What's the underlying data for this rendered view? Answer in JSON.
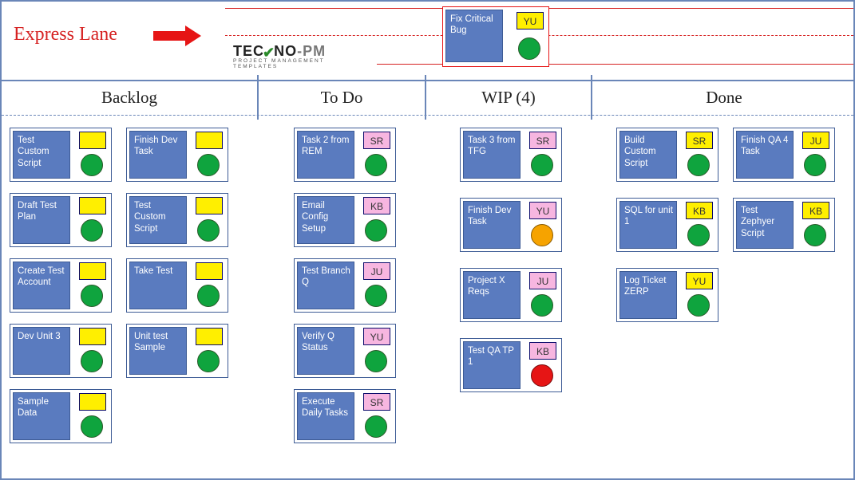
{
  "express_lane_label": "Express Lane",
  "logo": {
    "line1_a": "TEC",
    "tick": "✔",
    "line1_b": "NO",
    "gray": "-PM",
    "line2": "PROJECT MANAGEMENT TEMPLATES"
  },
  "express_card": {
    "title": "Fix\nCritical\nBug",
    "badge": "YU",
    "badge_color": "yellow",
    "status": "green"
  },
  "columns": [
    {
      "label": "Backlog"
    },
    {
      "label": "To Do"
    },
    {
      "label": "WIP (4)"
    },
    {
      "label": "Done"
    }
  ],
  "backlog_left": [
    {
      "title": "Test\nCustom\nScript",
      "badge": "",
      "badge_color": "yellow",
      "status": "green"
    },
    {
      "title": "Draft\nTest\nPlan",
      "badge": "",
      "badge_color": "yellow",
      "status": "green"
    },
    {
      "title": "Create\nTest\nAccount",
      "badge": "",
      "badge_color": "yellow",
      "status": "green"
    },
    {
      "title": "Dev\nUnit 3",
      "badge": "",
      "badge_color": "yellow",
      "status": "green"
    },
    {
      "title": "Sample\nData",
      "badge": "",
      "badge_color": "yellow",
      "status": "green"
    }
  ],
  "backlog_right": [
    {
      "title": "Finish\nDev\nTask",
      "badge": "",
      "badge_color": "yellow",
      "status": "green"
    },
    {
      "title": "Test\nCustom\nScript",
      "badge": "",
      "badge_color": "yellow",
      "status": "green"
    },
    {
      "title": "Take\nTest",
      "badge": "",
      "badge_color": "yellow",
      "status": "green"
    },
    {
      "title": "Unit test\nSample",
      "badge": "",
      "badge_color": "yellow",
      "status": "green"
    }
  ],
  "todo": [
    {
      "title": "Task 2\nfrom\nREM",
      "badge": "SR",
      "badge_color": "pink",
      "status": "green"
    },
    {
      "title": "Email\nConfig\nSetup",
      "badge": "KB",
      "badge_color": "pink",
      "status": "green"
    },
    {
      "title": "Test\nBranch\nQ",
      "badge": "JU",
      "badge_color": "pink",
      "status": "green"
    },
    {
      "title": "Verify Q\nStatus",
      "badge": "YU",
      "badge_color": "pink",
      "status": "green"
    },
    {
      "title": "Execute\nDaily\nTasks",
      "badge": "SR",
      "badge_color": "pink",
      "status": "green"
    }
  ],
  "wip": [
    {
      "title": "Task 3\nfrom\nTFG",
      "badge": "SR",
      "badge_color": "pink",
      "status": "green"
    },
    {
      "title": "Finish\nDev\nTask",
      "badge": "YU",
      "badge_color": "pink",
      "status": "amber"
    },
    {
      "title": "Project\nX Reqs",
      "badge": "JU",
      "badge_color": "pink",
      "status": "green"
    },
    {
      "title": "Test QA\nTP 1",
      "badge": "KB",
      "badge_color": "pink",
      "status": "red"
    }
  ],
  "done_left": [
    {
      "title": "Build\nCustom\nScript",
      "badge": "SR",
      "badge_color": "yellow",
      "status": "green"
    },
    {
      "title": "SQL for\nunit 1",
      "badge": "KB",
      "badge_color": "yellow",
      "status": "green"
    },
    {
      "title": "Log\nTicket\nZERP",
      "badge": "YU",
      "badge_color": "yellow",
      "status": "green"
    }
  ],
  "done_right": [
    {
      "title": "Finish\nQA 4\nTask",
      "badge": "JU",
      "badge_color": "yellow",
      "status": "green"
    },
    {
      "title": "Test\nZephyer\nScript",
      "badge": "KB",
      "badge_color": "yellow",
      "status": "green"
    }
  ]
}
